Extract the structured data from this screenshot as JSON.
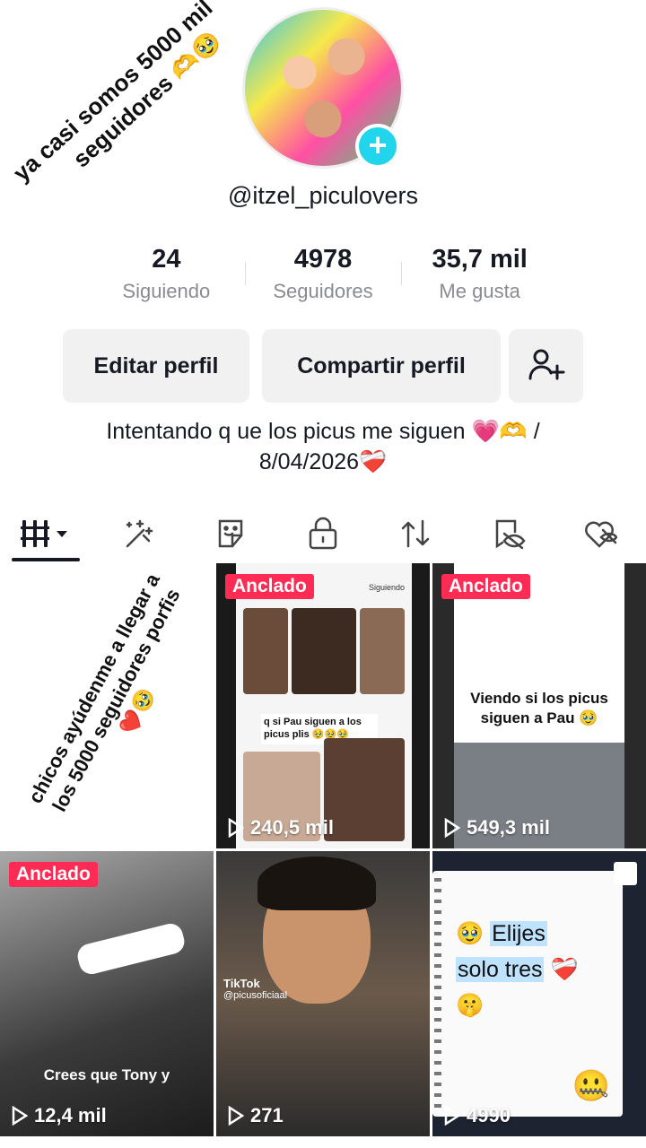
{
  "profile": {
    "overlay_note_line1": "ya casi somos 5000 mil",
    "overlay_note_line2": "seguidores 🫶🥹",
    "handle": "@itzel_piculovers",
    "bio_line1": "Intentando q ue los picus me siguen 💗🫶 /",
    "bio_line2": "8/04/2026❤️‍🩹"
  },
  "stats": [
    {
      "value": "24",
      "label": "Siguiendo"
    },
    {
      "value": "4978",
      "label": "Seguidores"
    },
    {
      "value": "35,7 mil",
      "label": "Me gusta"
    }
  ],
  "buttons": {
    "edit": "Editar perfil",
    "share": "Compartir perfil"
  },
  "tabs": [
    "videos-grid-icon",
    "sparkle-wand-icon",
    "sticker-icon",
    "lock-icon",
    "repost-icon",
    "eye-slash-icon",
    "heart-slash-icon"
  ],
  "videos": [
    {
      "caption": "chicos ayúdenme a llegar a los 5000 seguidores porfis ❤️🥹",
      "pinned": false,
      "views": ""
    },
    {
      "pinned_label": "Anclado",
      "views": "240,5 mil",
      "comment": "q si Pau siguen a los picus plis 🥹🥹🥹",
      "following_label": "Siguiendo"
    },
    {
      "pinned_label": "Anclado",
      "views": "549,3 mil",
      "text": "Viendo si los picus siguen a Pau 🥹"
    },
    {
      "pinned_label": "Anclado",
      "views": "12,4 mil",
      "caption": "Crees que Tony y"
    },
    {
      "views": "271",
      "watermark": "TikTok",
      "watermark_user": "@picusoficiaal"
    },
    {
      "views": "4990",
      "line1_emoji": "🥹",
      "line1": "Elijes",
      "line2": "solo tres",
      "line2_emoji": "❤️‍🩹",
      "line3": "🤫",
      "corner_emoji": "🤐"
    }
  ]
}
